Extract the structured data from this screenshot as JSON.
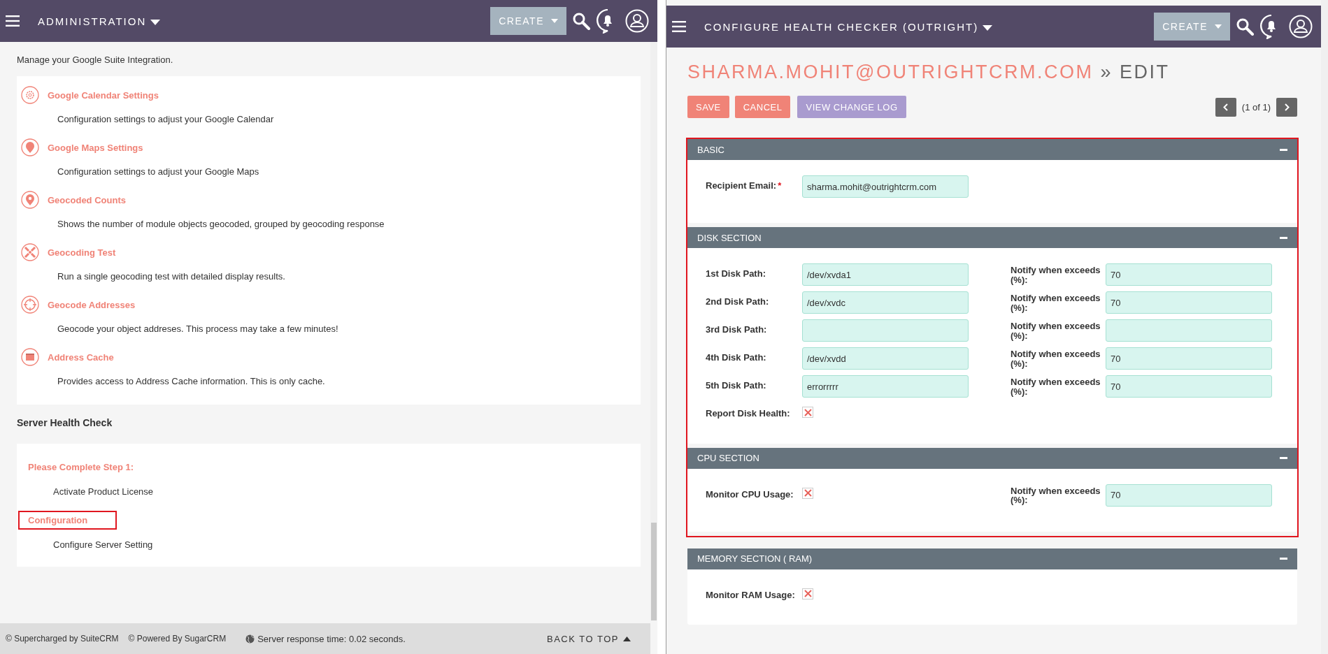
{
  "left": {
    "header": {
      "title": "ADMINISTRATION",
      "create": "CREATE"
    },
    "intro": "Manage your Google Suite Integration.",
    "items": [
      {
        "title": "Google Calendar Settings",
        "description": "Configuration settings to adjust your Google Calendar"
      },
      {
        "title": "Google Maps Settings",
        "description": "Configuration settings to adjust your Google Maps"
      },
      {
        "title": "Geocoded Counts",
        "description": "Shows the number of module objects geocoded, grouped by geocoding response"
      },
      {
        "title": "Geocoding Test",
        "description": "Run a single geocoding test with detailed display results."
      },
      {
        "title": "Geocode Addresses",
        "description": "Geocode your object addreses. This process may take a few minutes!"
      },
      {
        "title": "Address Cache",
        "description": "Provides access to Address Cache information. This is only cache."
      }
    ],
    "section_title": "Server Health Check",
    "health_items": [
      {
        "title": "Please Complete Step 1:",
        "description": "Activate Product License",
        "highlighted": false
      },
      {
        "title": "Configuration",
        "description": "Configure Server Setting",
        "highlighted": true
      }
    ],
    "footer": {
      "supercharged": "© Supercharged by SuiteCRM",
      "powered": "© Powered By SugarCRM",
      "response": "Server response time: 0.02 seconds.",
      "back_to_top": "BACK TO TOP"
    }
  },
  "right": {
    "header": {
      "title": "CONFIGURE HEALTH CHECKER (OUTRIGHT)",
      "create": "CREATE"
    },
    "heading": {
      "record": "SHARMA.MOHIT@OUTRIGHTCRM.COM",
      "separator": "»",
      "action": "EDIT"
    },
    "buttons": [
      {
        "label": "SAVE",
        "kind": "primary"
      },
      {
        "label": "CANCEL",
        "kind": "primary"
      },
      {
        "label": "VIEW CHANGE LOG",
        "kind": "secondary"
      }
    ],
    "pagination": "(1 of 1)",
    "panel_groups": [
      {
        "highlighted": true,
        "panels": [
          {
            "title": "BASIC",
            "rows": [
              [
                {
                  "kind": "text",
                  "label": "Recipient Email:",
                  "required_mark": "*",
                  "value": "sharma.mohit@outrightcrm.com"
                }
              ]
            ]
          },
          {
            "title": "DISK SECTION",
            "rows": [
              [
                {
                  "kind": "text",
                  "label": "1st Disk Path:",
                  "value": "/dev/xvda1"
                },
                {
                  "kind": "text",
                  "label": "Notify when exceeds (%):",
                  "value": "70"
                }
              ],
              [
                {
                  "kind": "text",
                  "label": "2nd Disk Path:",
                  "value": "/dev/xvdc"
                },
                {
                  "kind": "text",
                  "label": "Notify when exceeds (%):",
                  "value": "70"
                }
              ],
              [
                {
                  "kind": "text",
                  "label": "3rd Disk Path:"
                },
                {
                  "kind": "text",
                  "label": "Notify when exceeds (%):"
                }
              ],
              [
                {
                  "kind": "text",
                  "label": "4th Disk Path:",
                  "value": "/dev/xvdd"
                },
                {
                  "kind": "text",
                  "label": "Notify when exceeds (%):",
                  "value": "70"
                }
              ],
              [
                {
                  "kind": "text",
                  "label": "5th Disk Path:",
                  "value": "errorrrrr"
                },
                {
                  "kind": "text",
                  "label": "Notify when exceeds (%):",
                  "value": "70"
                }
              ],
              [
                {
                  "kind": "checkbox",
                  "label": "Report Disk Health:",
                  "checked": true
                }
              ]
            ]
          },
          {
            "title": "CPU SECTION",
            "rows": [
              [
                {
                  "kind": "checkbox",
                  "label": "Monitor CPU Usage:",
                  "checked": true
                },
                {
                  "kind": "text",
                  "label": "Notify when exceeds (%):",
                  "value": "70"
                }
              ]
            ]
          }
        ]
      },
      {
        "highlighted": false,
        "panels": [
          {
            "title": "MEMORY SECTION ( RAM)",
            "rows": [
              [
                {
                  "kind": "checkbox",
                  "label": "Monitor RAM Usage:",
                  "checked": true
                }
              ]
            ]
          }
        ]
      }
    ]
  }
}
